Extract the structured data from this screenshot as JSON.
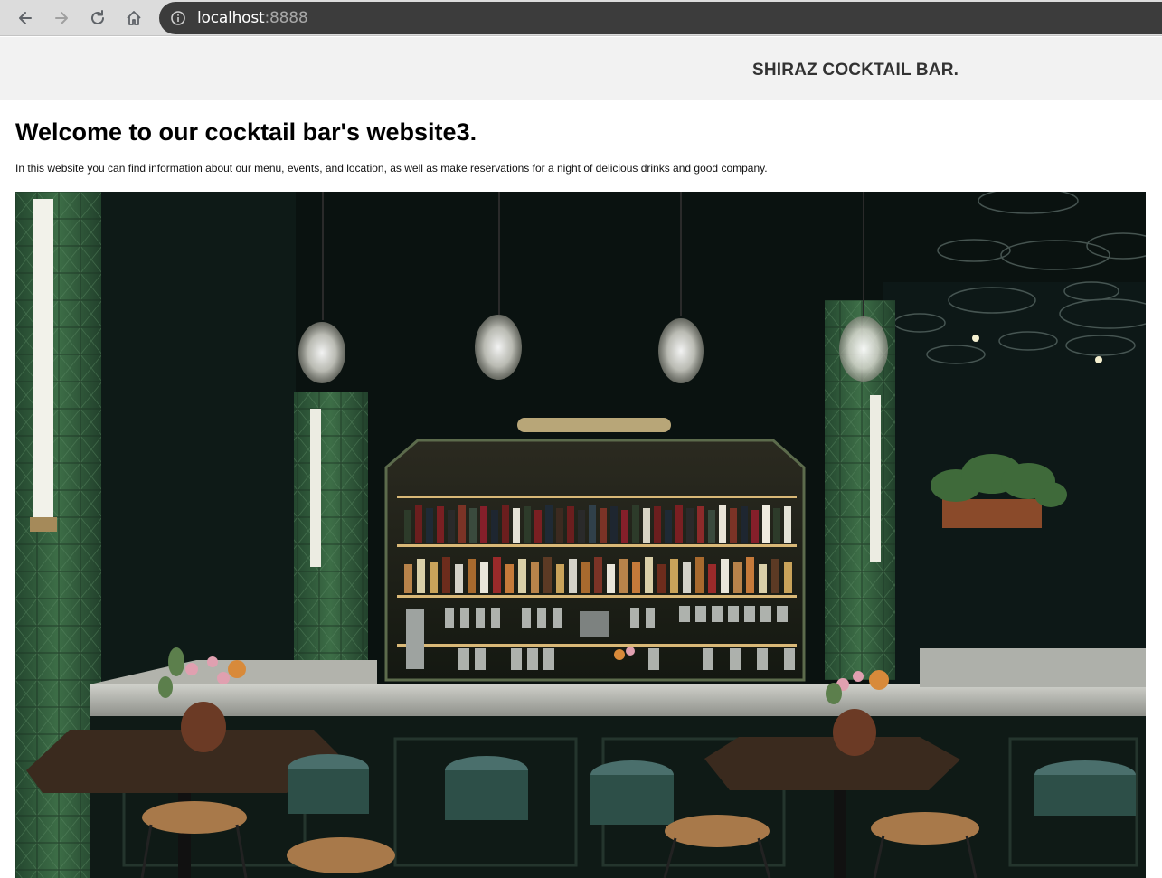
{
  "browser": {
    "url_host": "localhost",
    "url_port": ":8888",
    "icons": [
      "back-arrow-icon",
      "forward-arrow-icon",
      "reload-icon",
      "home-icon",
      "info-icon"
    ]
  },
  "header": {
    "brand": "SHIRAZ COCKTAIL BAR."
  },
  "main": {
    "title": "Welcome to our cocktail bar's website3.",
    "intro": "In this website you can find information about our menu, events, and location, as well as make reservations for a night of delicious drinks and good company."
  },
  "hero": {
    "subject": "cocktail-bar-interior-photo",
    "colors": {
      "wall": "#0b1411",
      "tile": "#2f5a3a",
      "counter": "#b9bab3",
      "table": "#3a2a1e",
      "stool": "#3e6a66",
      "lamp": "#e8e8e0"
    }
  }
}
